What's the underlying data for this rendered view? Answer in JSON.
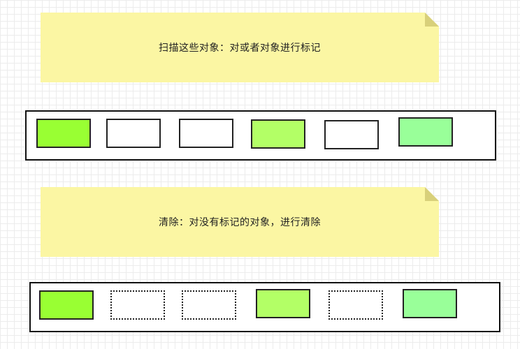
{
  "colors": {
    "note_fill": "#fbf6a3",
    "note_fold": "#d8d07a",
    "grid": "#ececec",
    "marked_bright": "#99ff33",
    "marked_light": "#b3ff66",
    "marked_mint": "#99ff99",
    "unmarked": "#ffffff"
  },
  "step1": {
    "note_text": "扫描这些对象：对或者对象进行标记",
    "objects": [
      {
        "state": "marked",
        "color": "#99ff33"
      },
      {
        "state": "unmarked",
        "color": "#ffffff"
      },
      {
        "state": "unmarked",
        "color": "#ffffff"
      },
      {
        "state": "marked",
        "color": "#b3ff66"
      },
      {
        "state": "unmarked",
        "color": "#ffffff"
      },
      {
        "state": "marked",
        "color": "#99ff99"
      }
    ]
  },
  "step2": {
    "note_text": "清除：对没有标记的对象，进行清除",
    "objects": [
      {
        "state": "kept",
        "color": "#99ff33"
      },
      {
        "state": "cleared",
        "color": "transparent"
      },
      {
        "state": "cleared",
        "color": "transparent"
      },
      {
        "state": "kept",
        "color": "#b3ff66"
      },
      {
        "state": "cleared",
        "color": "transparent"
      },
      {
        "state": "kept",
        "color": "#99ff99"
      }
    ]
  }
}
